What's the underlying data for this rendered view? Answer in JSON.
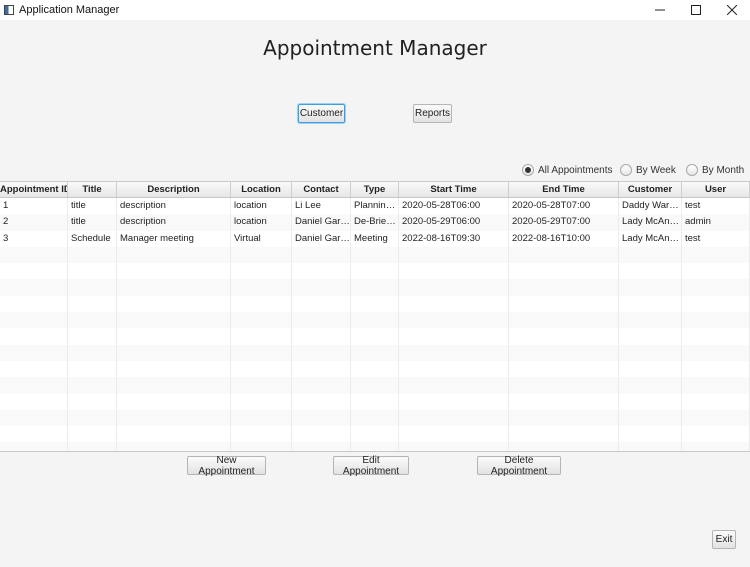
{
  "window": {
    "title": "Application Manager",
    "controls": {
      "minimize": "—",
      "maximize": "☐",
      "close": "✕"
    }
  },
  "header": {
    "title": "Appointment Manager"
  },
  "nav": {
    "customer_label": "Customer",
    "reports_label": "Reports"
  },
  "filter": {
    "options": [
      {
        "label": "All Appointments",
        "selected": true
      },
      {
        "label": "By Week",
        "selected": false
      },
      {
        "label": "By Month",
        "selected": false
      }
    ]
  },
  "table": {
    "columns": [
      "Appointment ID",
      "Title",
      "Description",
      "Location",
      "Contact",
      "Type",
      "Start Time",
      "End Time",
      "Customer",
      "User"
    ],
    "rows": [
      [
        "1",
        "title",
        "description",
        "location",
        "Li Lee",
        "Planning ...",
        "2020-05-28T06:00",
        "2020-05-28T07:00",
        "Daddy Warbu...",
        "test"
      ],
      [
        "2",
        "title",
        "description",
        "location",
        "Daniel Garcia",
        "De-Briefing",
        "2020-05-29T06:00",
        "2020-05-29T07:00",
        "Lady McAnder...",
        "admin"
      ],
      [
        "3",
        "Schedule",
        "Manager meeting",
        "Virtual",
        "Daniel Garcia",
        "Meeting",
        "2022-08-16T09:30",
        "2022-08-16T10:00",
        "Lady McAnder...",
        "test"
      ]
    ],
    "empty_rows": 13
  },
  "actions": {
    "new_label": "New Appointment",
    "edit_label": "Edit Appointment",
    "delete_label": "Delete Appointment",
    "exit_label": "Exit"
  },
  "colors": {
    "focus_ring": "#3b9fe3",
    "window_bg": "#f4f4f4"
  }
}
